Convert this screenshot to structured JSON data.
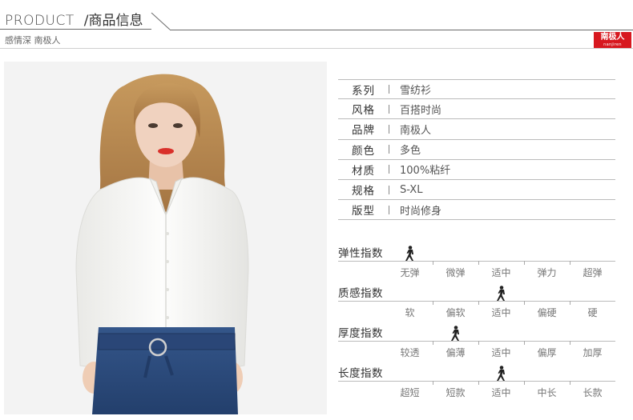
{
  "header": {
    "title_en": "PRODUCT",
    "title_cn": "/商品信息",
    "subtitle": "感情深 南极人"
  },
  "logo": {
    "cn": "南极人",
    "en": "nanjiren",
    "color": "#d7181f"
  },
  "specs": [
    {
      "label": "系列",
      "value": "雪纺衫"
    },
    {
      "label": "风格",
      "value": "百搭时尚"
    },
    {
      "label": "品牌",
      "value": "南极人"
    },
    {
      "label": "颜色",
      "value": "多色"
    },
    {
      "label": "材质",
      "value": "100%粘纤"
    },
    {
      "label": "规格",
      "value": "S-XL"
    },
    {
      "label": "版型",
      "value": "时尚修身"
    }
  ],
  "indices": [
    {
      "title": "弹性指数",
      "options": [
        "无弹",
        "微弹",
        "适中",
        "弹力",
        "超弹"
      ],
      "selected": 0
    },
    {
      "title": "质感指数",
      "options": [
        "软",
        "偏软",
        "适中",
        "偏硬",
        "硬"
      ],
      "selected": 2
    },
    {
      "title": "厚度指数",
      "options": [
        "较透",
        "偏薄",
        "适中",
        "偏厚",
        "加厚"
      ],
      "selected": 1
    },
    {
      "title": "长度指数",
      "options": [
        "超短",
        "短款",
        "适中",
        "中长",
        "长款"
      ],
      "selected": 2
    }
  ],
  "colors": {
    "line": "#6a6a6a",
    "brand_red": "#d7181f",
    "denim": "#2c4a7a",
    "shirt": "#fbfbfa"
  },
  "icons": {
    "marker": "walking-figure-icon"
  }
}
